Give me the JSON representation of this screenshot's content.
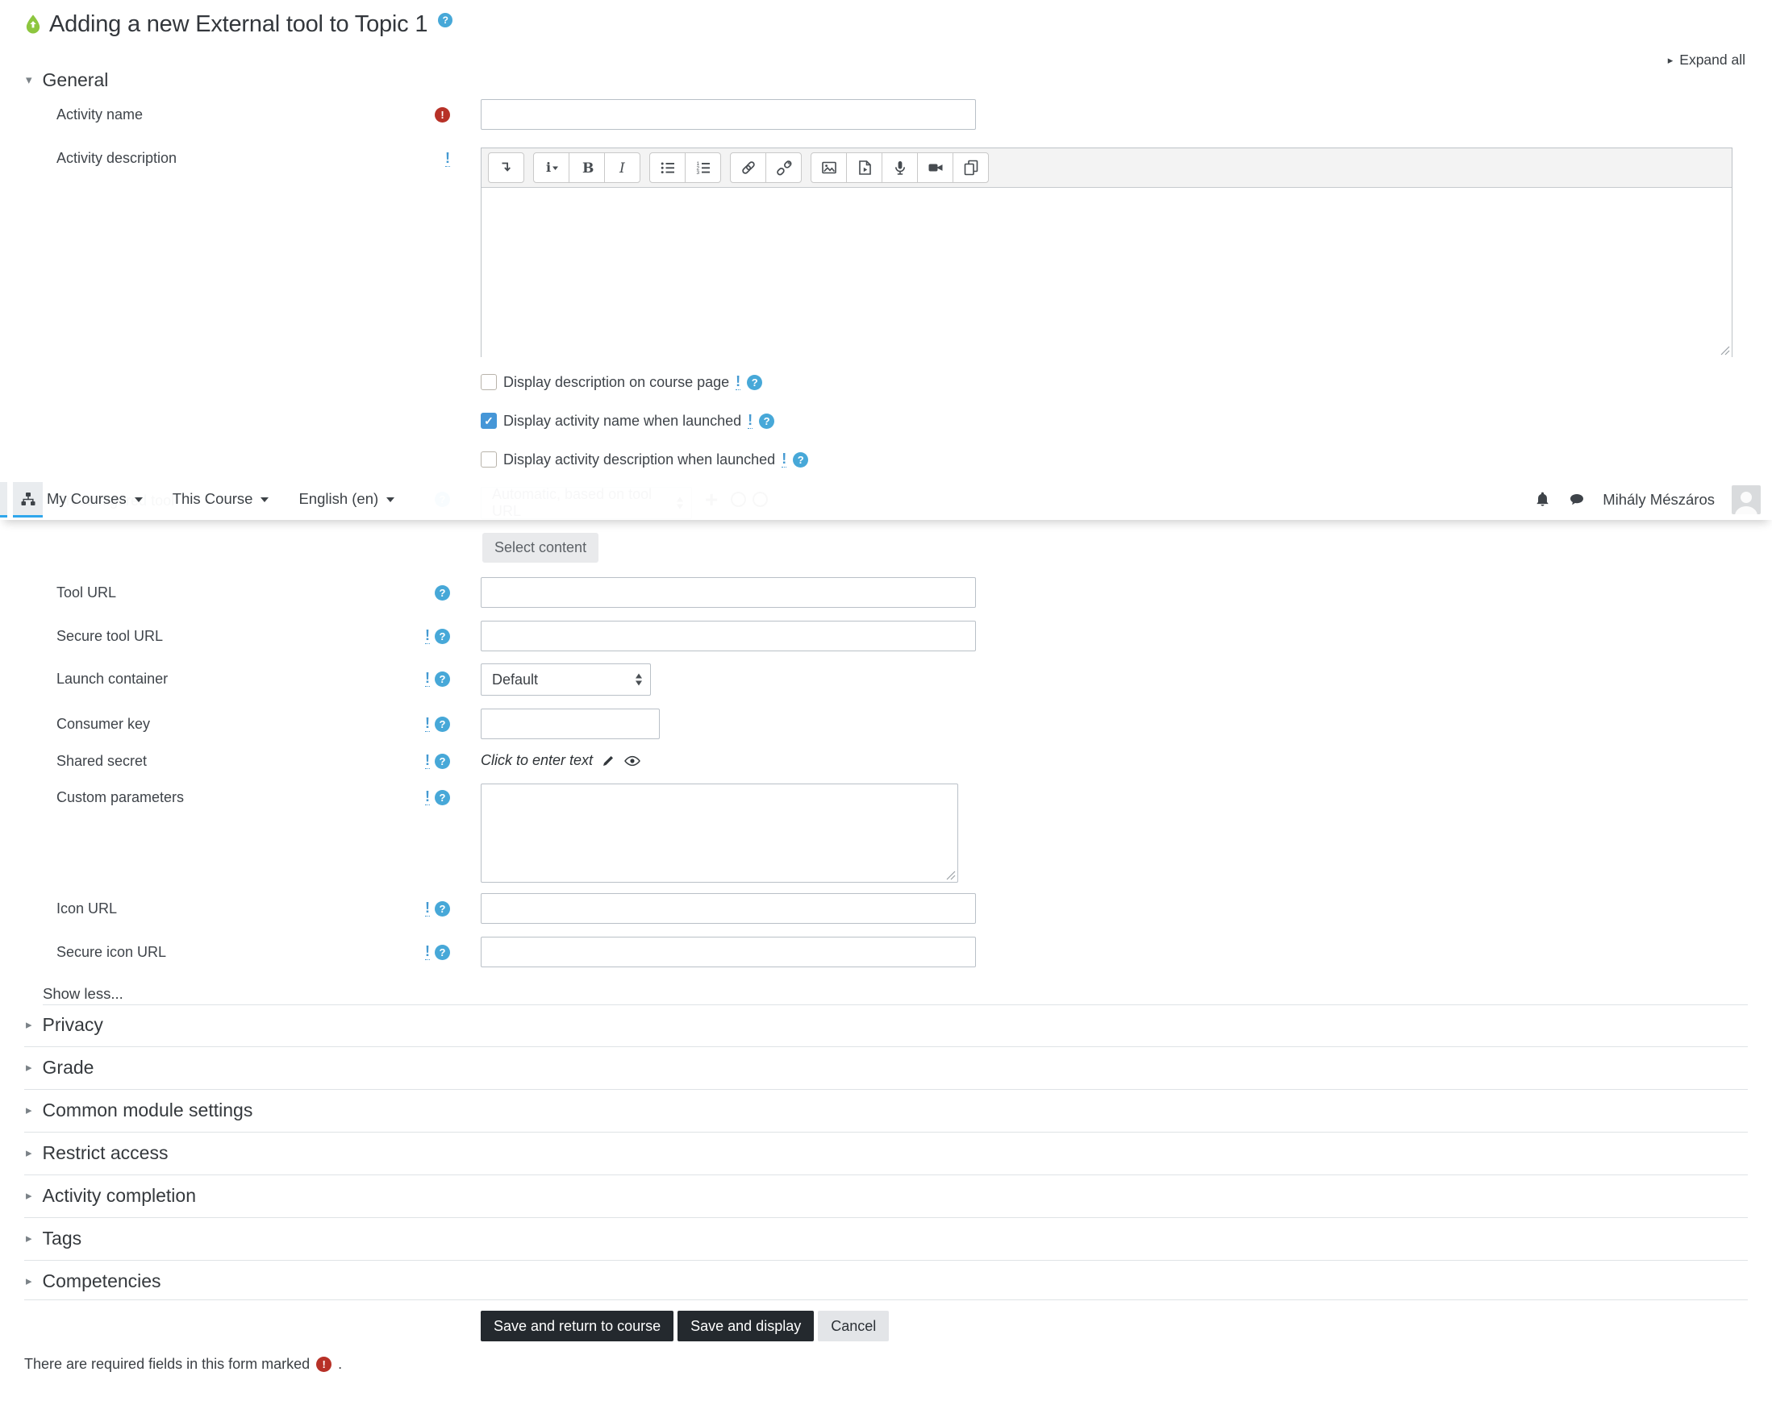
{
  "page": {
    "title": "Adding a new External tool to Topic 1",
    "expand_all": "Expand all",
    "required_note": "There are required fields in this form marked",
    "period": "."
  },
  "navbar": {
    "links": [
      "My Courses",
      "This Course",
      "English (en)"
    ],
    "user": "Mihály Mészáros"
  },
  "general": {
    "heading": "General",
    "activity_name_label": "Activity name",
    "activity_description_label": "Activity description",
    "checkboxes": [
      {
        "label": "Display description on course page",
        "checked": false
      },
      {
        "label": "Display activity name when launched",
        "checked": true
      },
      {
        "label": "Display activity description when launched",
        "checked": false
      }
    ]
  },
  "editor": {
    "toolbar": [
      "collapse-toolbar",
      "paragraph-styles",
      "bold",
      "italic",
      "unordered-list",
      "ordered-list",
      "link",
      "unlink",
      "insert-image",
      "insert-media",
      "record-audio",
      "record-video",
      "manage-files"
    ]
  },
  "ghost": {
    "label": "Preconfigured tool",
    "select_value": "Automatic, based on tool URL"
  },
  "fields": {
    "select_content": "Select content",
    "tool_url": "Tool URL",
    "secure_tool_url": "Secure tool URL",
    "launch_container": "Launch container",
    "launch_container_value": "Default",
    "consumer_key": "Consumer key",
    "shared_secret": "Shared secret",
    "shared_secret_value": "Click to enter text",
    "custom_parameters": "Custom parameters",
    "icon_url": "Icon URL",
    "secure_icon_url": "Secure icon URL",
    "show_less": "Show less..."
  },
  "sections": [
    "Privacy",
    "Grade",
    "Common module settings",
    "Restrict access",
    "Activity completion",
    "Tags",
    "Competencies"
  ],
  "buttons": {
    "save_return": "Save and return to course",
    "save_display": "Save and display",
    "cancel": "Cancel"
  },
  "glyphs": {
    "question": "?",
    "exclamation": "!",
    "triangle_right": "▸",
    "triangle_down": "▾",
    "check": "✓",
    "plus": "+"
  },
  "colors": {
    "accent_blue": "#2fa6ec",
    "help_blue": "#47a8d8",
    "tooltip_blue": "#459ad2",
    "required_red": "#b73127",
    "checkbox_checked": "#4596d7",
    "button_dark": "#24292e"
  }
}
